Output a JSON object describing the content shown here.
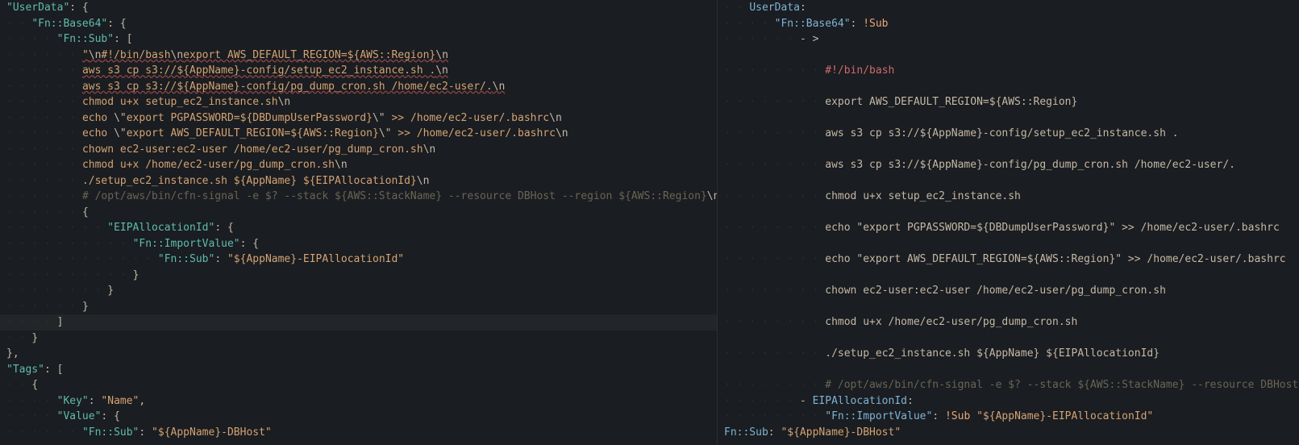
{
  "left": {
    "lines": [
      {
        "t": "key",
        "indent": 0,
        "key": "\"UserData\"",
        "after": ": {",
        "cls": "key"
      },
      {
        "t": "key",
        "indent": 1,
        "key": "\"Fn::Base64\"",
        "after": ": {",
        "cls": "key"
      },
      {
        "t": "key",
        "indent": 2,
        "key": "\"Fn::Sub\"",
        "after": ": [",
        "cls": "key"
      },
      {
        "t": "str-err",
        "indent": 3,
        "text": "\"\\n#!/bin/bash\\nexport AWS_DEFAULT_REGION=${AWS::Region}\\n"
      },
      {
        "t": "str-err",
        "indent": 3,
        "text": "aws s3 cp s3://${AppName}-config/setup_ec2_instance.sh .\\n"
      },
      {
        "t": "str-err",
        "indent": 3,
        "text": "aws s3 cp s3://${AppName}-config/pg_dump_cron.sh /home/ec2-user/.\\n"
      },
      {
        "t": "str",
        "indent": 3,
        "text": "chmod u+x setup_ec2_instance.sh\\n"
      },
      {
        "t": "str",
        "indent": 3,
        "text": "echo \\\"export PGPASSWORD=${DBDumpUserPassword}\\\" >> /home/ec2-user/.bashrc\\n"
      },
      {
        "t": "str",
        "indent": 3,
        "text": "echo \\\"export AWS_DEFAULT_REGION=${AWS::Region}\\\" >> /home/ec2-user/.bashrc\\n"
      },
      {
        "t": "str",
        "indent": 3,
        "text": "chown ec2-user:ec2-user /home/ec2-user/pg_dump_cron.sh\\n"
      },
      {
        "t": "str",
        "indent": 3,
        "text": "chmod u+x /home/ec2-user/pg_dump_cron.sh\\n"
      },
      {
        "t": "str",
        "indent": 3,
        "text": "./setup_ec2_instance.sh ${AppName} ${EIPAllocationId}\\n"
      },
      {
        "t": "str-comment",
        "indent": 3,
        "text": "# /opt/aws/bin/cfn-signal -e $? --stack ${AWS::StackName} --resource DBHost --region ${AWS::Region}\\n\","
      },
      {
        "t": "punct",
        "indent": 3,
        "text": "{"
      },
      {
        "t": "key",
        "indent": 4,
        "key": "\"EIPAllocationId\"",
        "after": ": {",
        "cls": "key"
      },
      {
        "t": "key",
        "indent": 5,
        "key": "\"Fn::ImportValue\"",
        "after": ": {",
        "cls": "key"
      },
      {
        "t": "keyval",
        "indent": 6,
        "key": "\"Fn::Sub\"",
        "val": "\"${AppName}-EIPAllocationId\""
      },
      {
        "t": "punct",
        "indent": 5,
        "text": "}"
      },
      {
        "t": "punct",
        "indent": 4,
        "text": "}"
      },
      {
        "t": "punct",
        "indent": 3,
        "text": "}"
      },
      {
        "t": "punct-hl",
        "indent": 2,
        "text": "]"
      },
      {
        "t": "punct",
        "indent": 1,
        "text": "}"
      },
      {
        "t": "punct",
        "indent": 0,
        "text": "},"
      },
      {
        "t": "key",
        "indent": 0,
        "key": "\"Tags\"",
        "after": ": [",
        "cls": "key"
      },
      {
        "t": "punct",
        "indent": 1,
        "text": "{"
      },
      {
        "t": "keyval",
        "indent": 2,
        "key": "\"Key\"",
        "val": "\"Name\"",
        "trail": ","
      },
      {
        "t": "key",
        "indent": 2,
        "key": "\"Value\"",
        "after": ": {",
        "cls": "key"
      },
      {
        "t": "keyval",
        "indent": 3,
        "key": "\"Fn::Sub\"",
        "val": "\"${AppName}-DBHost\""
      }
    ]
  },
  "right": {
    "lines": [
      {
        "t": "yaml-key",
        "indent": 0,
        "key": "UserData",
        "after": ":"
      },
      {
        "t": "yaml-kv",
        "indent": 1,
        "key": "\"Fn::Base64\"",
        "val": "!Sub"
      },
      {
        "t": "yaml-dash",
        "indent": 2,
        "text": "- >"
      },
      {
        "t": "blank"
      },
      {
        "t": "shebang",
        "indent": 3,
        "text": "#!/bin/bash"
      },
      {
        "t": "blank"
      },
      {
        "t": "bash",
        "indent": 3,
        "text": "export AWS_DEFAULT_REGION=${AWS::Region}"
      },
      {
        "t": "blank"
      },
      {
        "t": "bash",
        "indent": 3,
        "text": "aws s3 cp s3://${AppName}-config/setup_ec2_instance.sh ."
      },
      {
        "t": "blank"
      },
      {
        "t": "bash",
        "indent": 3,
        "text": "aws s3 cp s3://${AppName}-config/pg_dump_cron.sh /home/ec2-user/."
      },
      {
        "t": "blank"
      },
      {
        "t": "bash",
        "indent": 3,
        "text": "chmod u+x setup_ec2_instance.sh"
      },
      {
        "t": "blank"
      },
      {
        "t": "bash",
        "indent": 3,
        "text": "echo \"export PGPASSWORD=${DBDumpUserPassword}\" >> /home/ec2-user/.bashrc"
      },
      {
        "t": "blank"
      },
      {
        "t": "bash",
        "indent": 3,
        "text": "echo \"export AWS_DEFAULT_REGION=${AWS::Region}\" >> /home/ec2-user/.bashrc"
      },
      {
        "t": "blank"
      },
      {
        "t": "bash",
        "indent": 3,
        "text": "chown ec2-user:ec2-user /home/ec2-user/pg_dump_cron.sh"
      },
      {
        "t": "blank"
      },
      {
        "t": "bash",
        "indent": 3,
        "text": "chmod u+x /home/ec2-user/pg_dump_cron.sh"
      },
      {
        "t": "blank"
      },
      {
        "t": "bash",
        "indent": 3,
        "text": "./setup_ec2_instance.sh ${AppName} ${EIPAllocationId}"
      },
      {
        "t": "blank"
      },
      {
        "t": "comment",
        "indent": 3,
        "text": "# /opt/aws/bin/cfn-signal -e $? --stack ${AWS::StackName} --resource DBHost --re"
      },
      {
        "t": "yaml-kv-dash",
        "indent": 2,
        "key": "EIPAllocationId",
        "after": ":"
      },
      {
        "t": "yaml-kvv",
        "indent": 3,
        "key": "\"Fn::ImportValue\"",
        "tag": "!Sub",
        "val": "\"${AppName}-EIPAllocationId\""
      },
      {
        "t": "yaml-kv",
        "indent": 0,
        "prekey": "Fn::Sub",
        "val": "\"${AppName}-DBHost\""
      }
    ]
  }
}
